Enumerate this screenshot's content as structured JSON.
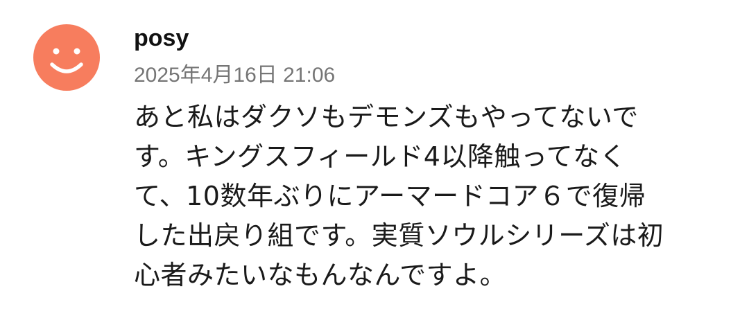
{
  "comment": {
    "author": "posy",
    "timestamp": "2025年4月16日 21:06",
    "avatar_icon": "smiley-face-icon",
    "avatar_color": "#f77d5e",
    "body_lines": [
      "あと私はダクソもデモンズもやってないで",
      "す。キングスフィールド4以降触ってなく",
      "て、10数年ぶりにアーマードコア６で復帰",
      "した出戻り組です。実質ソウルシリーズは初",
      "心者みたいなもんなんですよ。"
    ]
  }
}
